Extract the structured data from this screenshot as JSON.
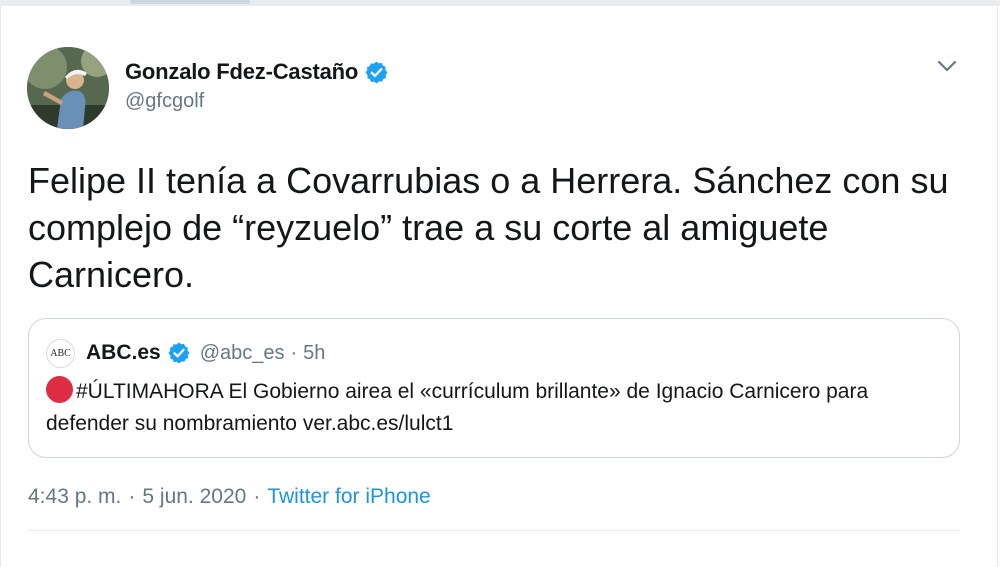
{
  "tweet": {
    "author_name": "Gonzalo Fdez-Castaño",
    "author_handle": "@gfcgolf",
    "text": "Felipe II tenía a Covarrubias o a Herrera. Sánchez con su complejo de “reyzuelo” trae a su corte al amiguete Carnicero.",
    "icons": {
      "verified": "verified-badge-icon",
      "menu": "chevron-down-icon"
    }
  },
  "quoted": {
    "avatar_text": "ABC",
    "name": "ABC.es",
    "handle": "@abc_es",
    "separator": "·",
    "time": "5h",
    "text": "#ÚLTIMAHORA El Gobierno airea el «currículum brillante» de Ignacio Carnicero para defender su nombramiento ver.abc.es/lulct1",
    "icons": {
      "red_circle": "red-circle-emoji-icon"
    }
  },
  "footer": {
    "time": "4:43 p. m.",
    "separator": "·",
    "date": "5 jun. 2020",
    "source": "Twitter for iPhone"
  },
  "colors": {
    "text": "#14171a",
    "secondary": "#657786",
    "link": "#1b95e0",
    "verified": "#1da1f2",
    "border": "#ccd6dd"
  }
}
